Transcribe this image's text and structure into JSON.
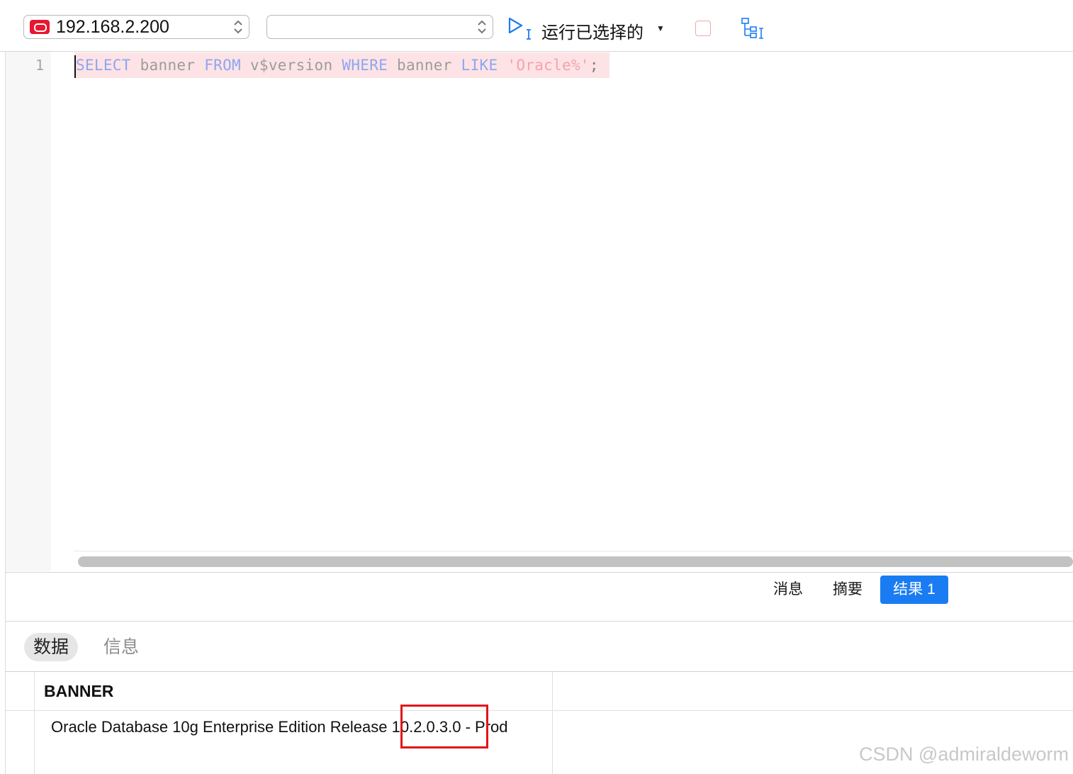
{
  "toolbar": {
    "connection": "192.168.2.200",
    "schema": "",
    "run_selected_label": "运行已选择的"
  },
  "editor": {
    "line_number": "1",
    "tokens": {
      "kw_select": "SELECT",
      "col1": " banner ",
      "kw_from": "FROM",
      "table": " v$version ",
      "kw_where": "WHERE",
      "col2": " banner ",
      "kw_like": "LIKE",
      "space": " ",
      "literal": "'Oracle%'",
      "semicolon": ";"
    }
  },
  "result_tabs": {
    "messages": "消息",
    "summary": "摘要",
    "result1": "结果 1"
  },
  "sub_tabs": {
    "data": "数据",
    "info": "信息"
  },
  "grid": {
    "column": "BANNER",
    "rows": [
      {
        "banner": "Oracle Database 10g Enterprise Edition Release 10.2.0.3.0 - Prod"
      }
    ]
  },
  "watermark": "CSDN @admiraldeworm",
  "colors": {
    "accent": "#1a7cf3",
    "highlight": "#e2141c",
    "oracle_brand": "#e8172f"
  }
}
